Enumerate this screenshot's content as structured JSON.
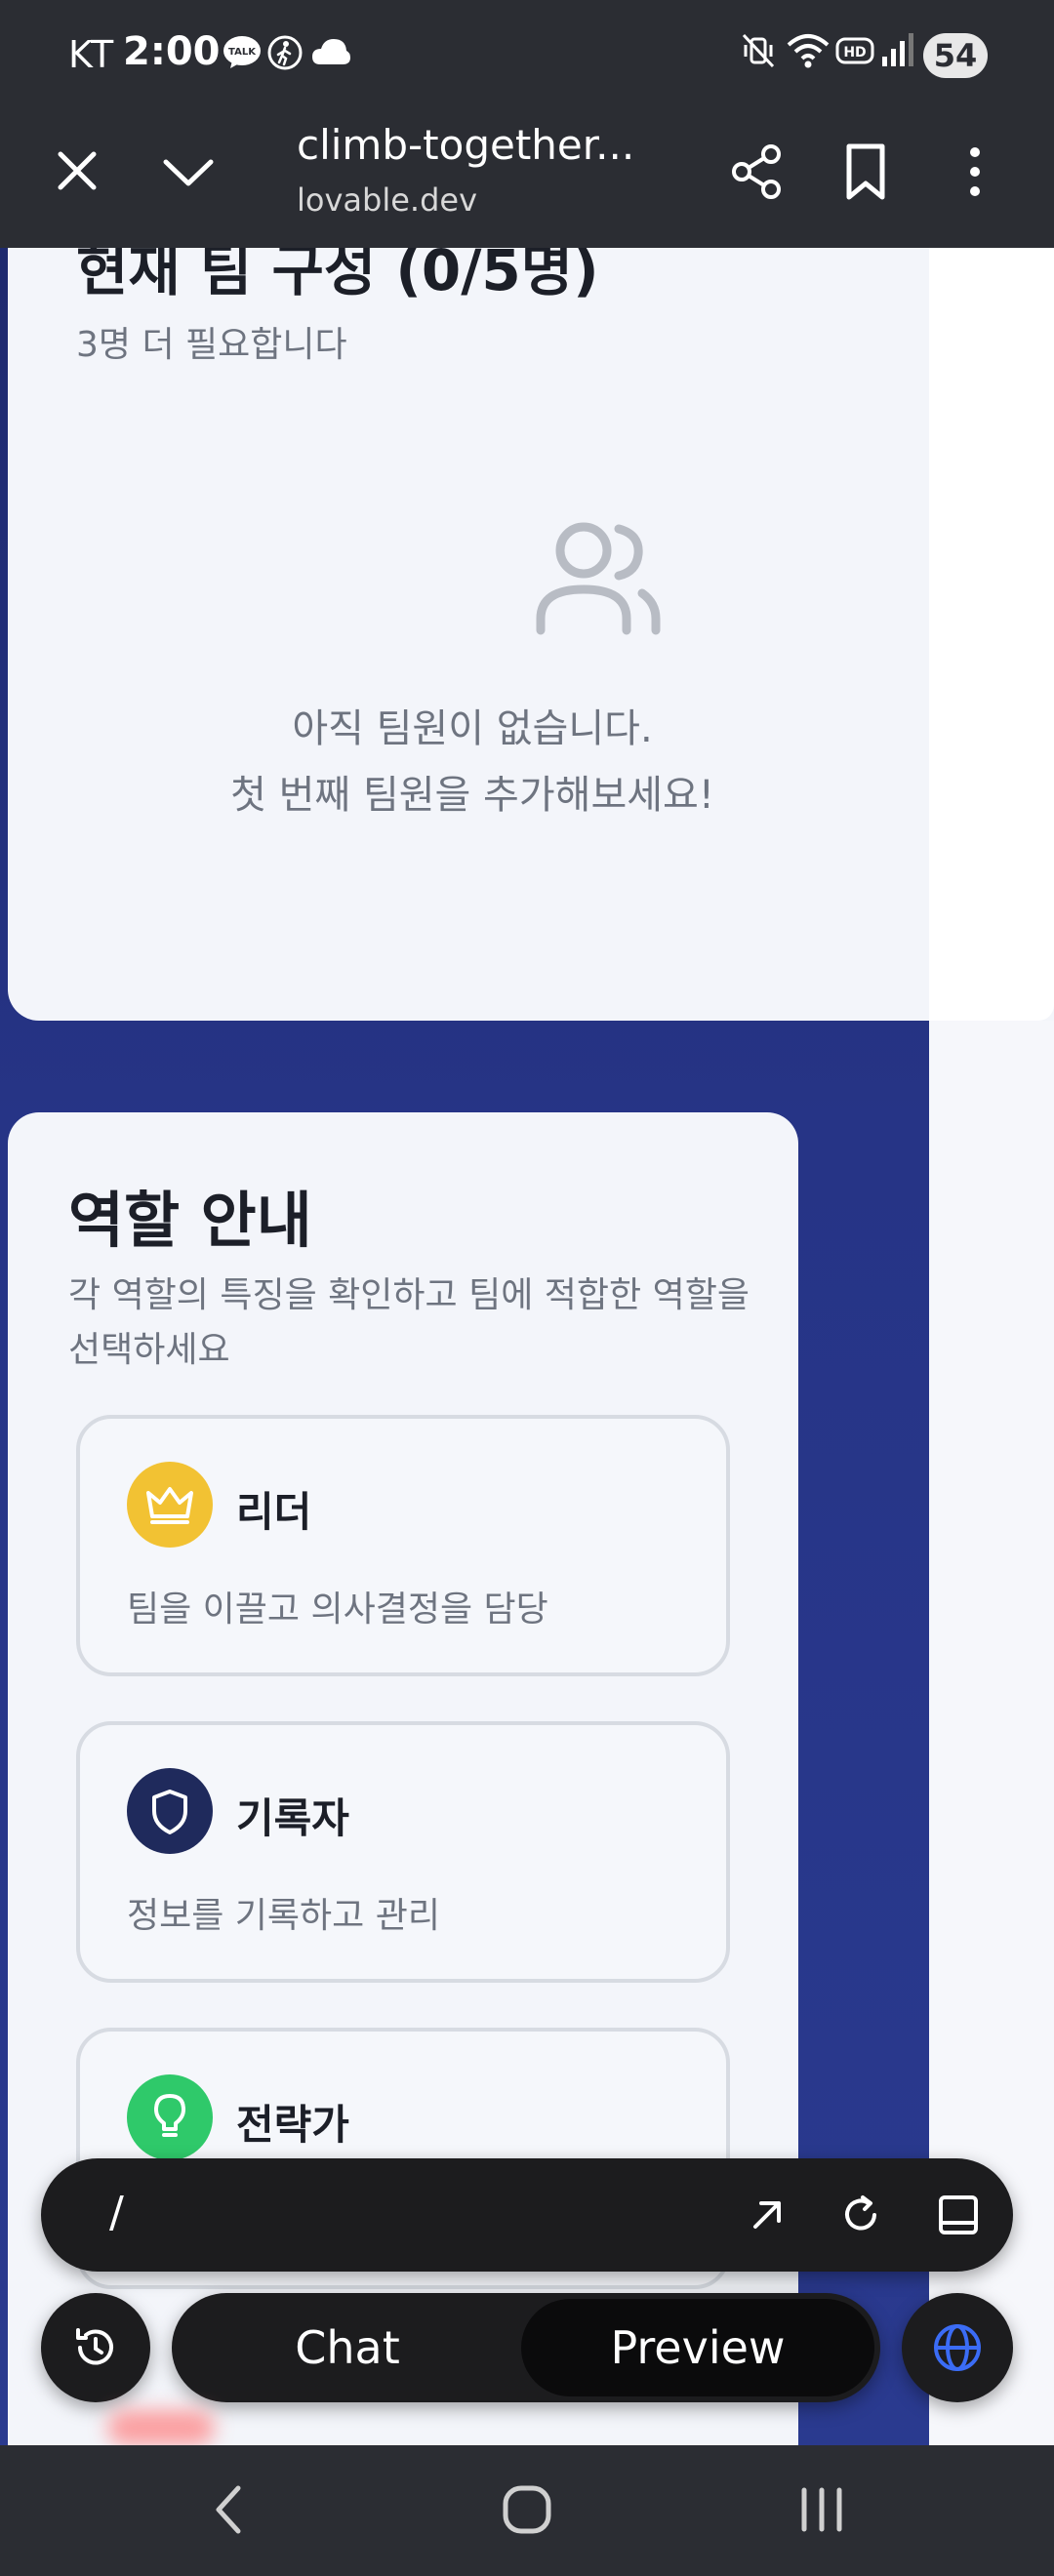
{
  "status_bar": {
    "carrier": "KT",
    "time": "2:00",
    "notif_icons": [
      "talk-icon",
      "walk-icon",
      "cloud-icon"
    ],
    "right_icons": [
      "mute-vibrate-icon",
      "wifi-icon",
      "hd-icon",
      "signal-icon"
    ],
    "battery": "54"
  },
  "browser": {
    "page_title": "climb-together...",
    "domain": "lovable.dev"
  },
  "team": {
    "title": "현재 팀 구성 (0/5명)",
    "subtitle": "3명 더 필요합니다",
    "empty_line1": "아직 팀원이 없습니다.",
    "empty_line2": "첫 번째 팀원을 추가해보세요!"
  },
  "roles": {
    "title": "역할 안내",
    "subtitle": "각 역할의 특징을 확인하고 팀에 적합한 역할을 선택하세요",
    "items": [
      {
        "name": "리더",
        "desc": "팀을 이끌고 의사결정을 담당",
        "icon": "crown-icon",
        "color": "#f2c233"
      },
      {
        "name": "기록자",
        "desc": "정보를 기록하고 관리",
        "icon": "shield-icon",
        "color": "#1f2a5c"
      },
      {
        "name": "전략가",
        "desc": "",
        "icon": "lightbulb-icon",
        "color": "#2fc96a"
      }
    ]
  },
  "lovable_bar": {
    "path": "/",
    "chat_label": "Chat",
    "preview_label": "Preview"
  },
  "colors": {
    "page_bg": "#26327a",
    "card_bg": "#f3f5fa",
    "dark_chrome": "#2b2d33"
  }
}
